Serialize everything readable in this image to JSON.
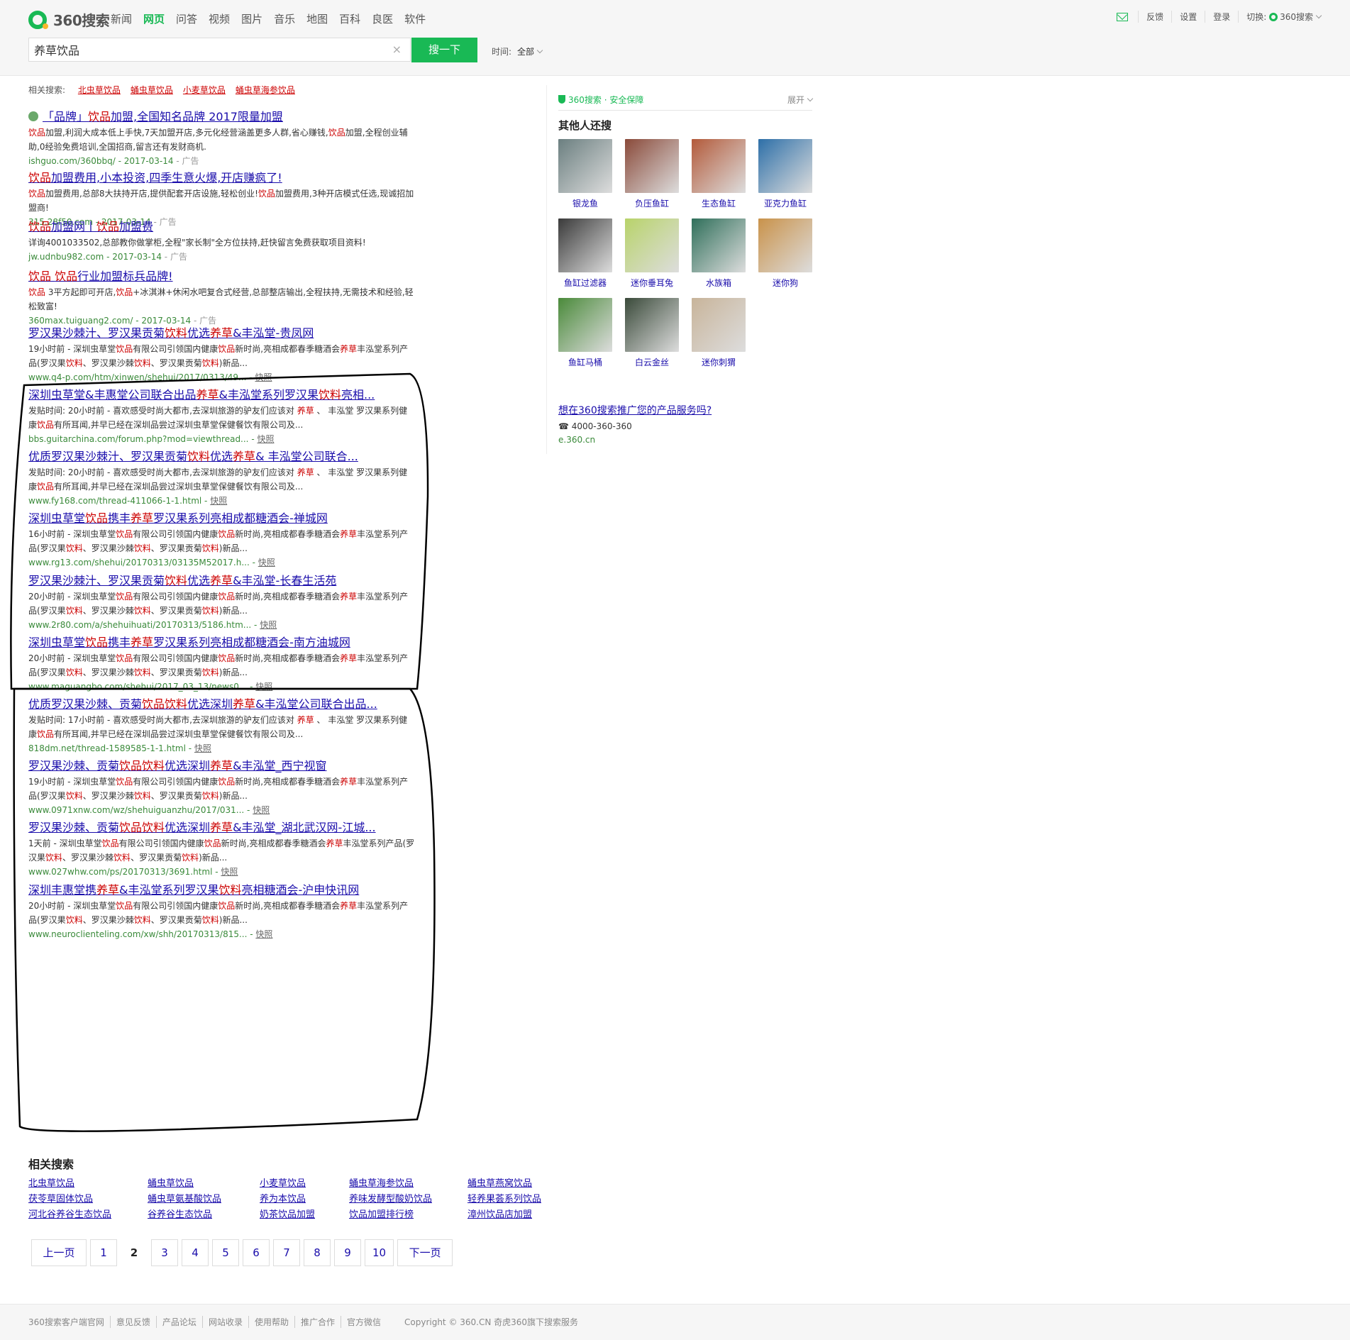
{
  "header": {
    "logo_text": "360搜索",
    "nav": [
      "新闻",
      "网页",
      "问答",
      "视频",
      "图片",
      "音乐",
      "地图",
      "百科",
      "良医",
      "软件"
    ],
    "nav_active": "网页",
    "top_right": {
      "feedback": "反馈",
      "settings": "设置",
      "login": "登录",
      "switch_label": "切换:",
      "switch_value": "360搜索"
    },
    "search": {
      "value": "养草饮品",
      "button": "搜一下",
      "clear": "×"
    },
    "time_filter": {
      "label": "时间:",
      "value": "全部"
    }
  },
  "related_top": {
    "label": "相关搜索:",
    "items": [
      "北虫草饮品",
      "蛹虫草饮品",
      "小麦草饮品",
      "蛹虫草海参饮品"
    ]
  },
  "results": [
    {
      "title": "「品牌」<em>饮品</em>加盟,全国知名品牌 2017限量加盟",
      "desc": "<em>饮品</em>加盟,利润大成本低上手快,7天加盟开店,多元化经营涵盖更多人群,省心赚钱,<em>饮品</em>加盟,全程创业辅助,0经验免费培训,全国招商,留言还有发财商机.",
      "url": "ishguo.com/360bbq/ - 2017-03-14",
      "ad": "- 广告",
      "snap": ""
    },
    {
      "title": "<em>饮品</em>加盟费用,小本投资,四季生意火爆,开店赚疯了!",
      "desc": "<em>饮品</em>加盟费用,总部8大扶持开店,提供配套开店设施,轻松创业!<em>饮品</em>加盟费用,3种开店模式任选,现诚招加盟商!",
      "url": "315.28f50.com - 2017-03-14",
      "ad": "- 广告",
      "snap": ""
    },
    {
      "title": "<em>饮品</em>加盟网丨<em>饮品</em>加盟费",
      "desc": "详询4001033502,总部教你做掌柜,全程\"家长制\"全方位扶持,赶快留言免费获取项目资料!",
      "url": "jw.udnbu982.com - 2017-03-14",
      "ad": "- 广告",
      "snap": ""
    },
    {
      "title": "<em>饮品</em> <em>饮品</em>行业加盟标兵品牌!",
      "desc": "<em>饮品</em> 3平方起即可开店,<em>饮品</em>+冰淇淋+休闲水吧复合式经营,总部整店输出,全程扶持,无需技术和经验,轻松致富!",
      "url": "360max.tuiguang2.com/ - 2017-03-14",
      "ad": "- 广告",
      "snap": ""
    },
    {
      "title": "罗汉果沙棘汁、罗汉果贡菊<em>饮料</em>优选<em>养草</em>&丰泓堂-贵凤网",
      "desc": "19小时前 - 深圳虫草堂<em>饮品</em>有限公司引领国内健康<em>饮品</em>新时尚,亮相成都春季糖酒会<em>养草</em>丰泓堂系列产品(罗汉果<em>饮料</em>、罗汉果沙棘<em>饮料</em>、罗汉果贡菊<em>饮料</em>)新品...",
      "url": "www.q4-p.com/htm/xinwen/shehui/2017/0313/49...",
      "ad": "",
      "snap": "快照"
    },
    {
      "title": "深圳虫草堂&丰惠堂公司联合出品<em>养草</em>&丰泓堂系列罗汉果<em>饮料</em>亮相...",
      "desc": "发贴时间: 20小时前 - 喜欢感受时尚大都市,去深圳旅游的驴友们应该对 <em>养草</em> 、 丰泓堂 罗汉果系列健康<em>饮品</em>有所耳闻,并早已经在深圳品尝过深圳虫草堂保健餐饮有限公司及...",
      "url": "bbs.guitarchina.com/forum.php?mod=viewthread...",
      "ad": "",
      "snap": "快照"
    },
    {
      "title": "优质罗汉果沙棘汁、罗汉果贡菊<em>饮料</em>优选<em>养草</em>& 丰泓堂公司联合...",
      "desc": "发贴时间: 20小时前 - 喜欢感受时尚大都市,去深圳旅游的驴友们应该对 <em>养草</em> 、 丰泓堂 罗汉果系列健康<em>饮品</em>有所耳闻,并早已经在深圳品尝过深圳虫草堂保健餐饮有限公司及...",
      "url": "www.fy168.com/thread-411066-1-1.html",
      "ad": "",
      "snap": "快照"
    },
    {
      "title": "深圳虫草堂<em>饮品</em>携丰<em>养草</em>罗汉果系列亮相成都糖酒会-禅城网",
      "desc": "16小时前 - 深圳虫草堂<em>饮品</em>有限公司引领国内健康<em>饮品</em>新时尚,亮相成都春季糖酒会<em>养草</em>丰泓堂系列产品(罗汉果<em>饮料</em>、罗汉果沙棘<em>饮料</em>、罗汉果贡菊<em>饮料</em>)新品...",
      "url": "www.rg13.com/shehui/20170313/03135M52017.h...",
      "ad": "",
      "snap": "快照"
    },
    {
      "title": "罗汉果沙棘汁、罗汉果贡菊<em>饮料</em>优选<em>养草</em>&丰泓堂-长春生活苑",
      "desc": "20小时前 - 深圳虫草堂<em>饮品</em>有限公司引领国内健康<em>饮品</em>新时尚,亮相成都春季糖酒会<em>养草</em>丰泓堂系列产品(罗汉果<em>饮料</em>、罗汉果沙棘<em>饮料</em>、罗汉果贡菊<em>饮料</em>)新品...",
      "url": "www.2r80.com/a/shehuihuati/20170313/5186.htm...",
      "ad": "",
      "snap": "快照"
    },
    {
      "title": "深圳虫草堂<em>饮品</em>携丰<em>养草</em>罗汉果系列亮相成都糖酒会-南方油城网",
      "desc": "20小时前 - 深圳虫草堂<em>饮品</em>有限公司引领国内健康<em>饮品</em>新时尚,亮相成都春季糖酒会<em>养草</em>丰泓堂系列产品(罗汉果<em>饮料</em>、罗汉果沙棘<em>饮料</em>、罗汉果贡菊<em>饮料</em>)新品...",
      "url": "www.maguangbo.com/shehui/2017_03_13/news0...",
      "ad": "",
      "snap": "快照"
    },
    {
      "title": "优质罗汉果沙棘、贡菊<em>饮品饮料</em>优选深圳<em>养草</em>&丰泓堂公司联合出品...",
      "desc": "发贴时间: 17小时前 - 喜欢感受时尚大都市,去深圳旅游的驴友们应该对 <em>养草</em> 、 丰泓堂 罗汉果系列健康<em>饮品</em>有所耳闻,并早已经在深圳品尝过深圳虫草堂保健餐饮有限公司及...",
      "url": "818dm.net/thread-1589585-1-1.html",
      "ad": "",
      "snap": "快照"
    },
    {
      "title": "罗汉果沙棘、贡菊<em>饮品饮料</em>优选深圳<em>养草</em>&丰泓堂_西宁视窗",
      "desc": "19小时前 - 深圳虫草堂<em>饮品</em>有限公司引领国内健康<em>饮品</em>新时尚,亮相成都春季糖酒会<em>养草</em>丰泓堂系列产品(罗汉果<em>饮料</em>、罗汉果沙棘<em>饮料</em>、罗汉果贡菊<em>饮料</em>)新品...",
      "url": "www.0971xnw.com/wz/shehuiguanzhu/2017/031...",
      "ad": "",
      "snap": "快照"
    },
    {
      "title": "罗汉果沙棘、贡菊<em>饮品饮料</em>优选深圳<em>养草</em>&丰泓堂_湖北武汉网-江城...",
      "desc": "1天前 - 深圳虫草堂<em>饮品</em>有限公司引领国内健康<em>饮品</em>新时尚,亮相成都春季糖酒会<em>养草</em>丰泓堂系列产品(罗汉果<em>饮料</em>、罗汉果沙棘<em>饮料</em>、罗汉果贡菊<em>饮料</em>)新品...",
      "url": "www.027whw.com/ps/20170313/3691.html",
      "ad": "",
      "snap": "快照"
    },
    {
      "title": "深圳丰惠堂携<em>养草</em>&丰泓堂系列罗汉果<em>饮料</em>亮相糖酒会-沪申快讯网",
      "desc": "20小时前 - 深圳虫草堂<em>饮品</em>有限公司引领国内健康<em>饮品</em>新时尚,亮相成都春季糖酒会<em>养草</em>丰泓堂系列产品(罗汉果<em>饮料</em>、罗汉果沙棘<em>饮料</em>、罗汉果贡菊<em>饮料</em>)新品...",
      "url": "www.neuroclienteling.com/xw/shh/20170313/815...",
      "ad": "",
      "snap": "快照"
    }
  ],
  "right": {
    "head": "360搜索 · 安全保障",
    "expand": "展开",
    "title": "其他人还搜",
    "thumbs": [
      {
        "label": "银龙鱼",
        "color": "#6b7f80"
      },
      {
        "label": "负压鱼缸",
        "color": "#8a4a3a"
      },
      {
        "label": "生态鱼缸",
        "color": "#b35a3a"
      },
      {
        "label": "亚克力鱼缸",
        "color": "#2d6fa8"
      },
      {
        "label": "鱼缸过滤器",
        "color": "#3a3a3a"
      },
      {
        "label": "迷你垂耳兔",
        "color": "#b8d36a"
      },
      {
        "label": "水族箱",
        "color": "#2f6f5a"
      },
      {
        "label": "迷你狗",
        "color": "#c9924a"
      },
      {
        "label": "鱼缸马桶",
        "color": "#4a8a3a"
      },
      {
        "label": "白云金丝",
        "color": "#3a4a3a"
      },
      {
        "label": "迷你刺猬",
        "color": "#c8b49a"
      }
    ],
    "promo": "想在360搜索推广您的产品服务吗?",
    "phone": "☎ 4000-360-360",
    "site": "e.360.cn"
  },
  "bottom_related": {
    "title": "相关搜索",
    "items": [
      "北虫草饮品",
      "蛹虫草饮品",
      "小麦草饮品",
      "蛹虫草海参饮品",
      "蛹虫草燕窝饮品",
      "茯苓草固体饮品",
      "蛹虫草氨基酸饮品",
      "养为本饮品",
      "养味发酵型酸奶饮品",
      "轻养果荟系列饮品",
      "河北谷养谷生态饮品",
      "谷养谷生态饮品",
      "奶茶饮品加盟",
      "饮品加盟排行榜",
      "漳州饮品店加盟"
    ]
  },
  "pagination": {
    "prev": "上一页",
    "pages": [
      "1",
      "2",
      "3",
      "4",
      "5",
      "6",
      "7",
      "8",
      "9",
      "10"
    ],
    "current": "2",
    "next": "下一页"
  },
  "footer": {
    "links": [
      "360搜索客户端官网",
      "意见反馈",
      "产品论坛",
      "网站收录",
      "使用帮助",
      "推广合作",
      "官方微信"
    ],
    "copyright": "Copyright © 360.CN 奇虎360旗下搜索服务"
  }
}
